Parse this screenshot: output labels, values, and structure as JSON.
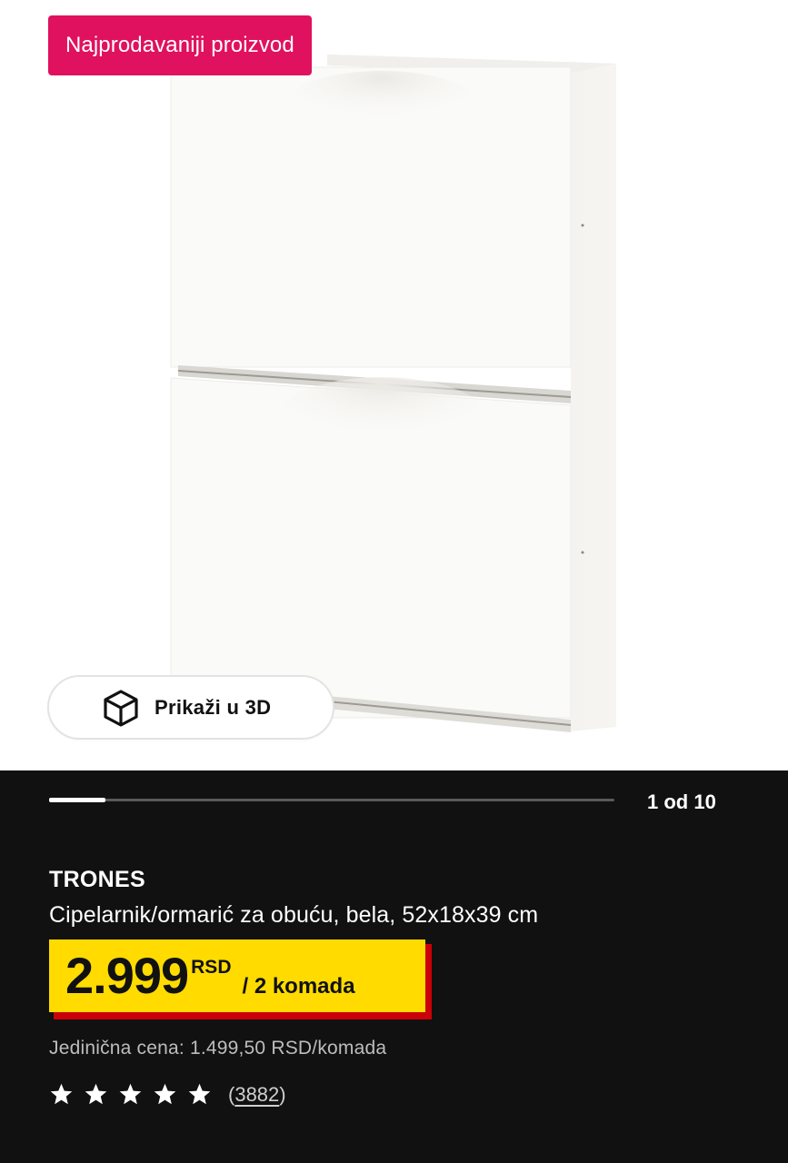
{
  "gallery": {
    "badge": "Najprodavaniji proizvod",
    "view_3d_label": "Prikaži u 3D",
    "image_description": "white shoe cabinet with two tilting compartments",
    "progress": 0.1,
    "pager": "1 od 10"
  },
  "product": {
    "name": "TRONES",
    "description": "Cipelarnik/ormarić za obuću, bela, 52x18x39 cm",
    "price": {
      "amount": "2.999",
      "currency": "RSD",
      "unit": "/ 2 komada"
    },
    "unit_price": "Jedinična cena: 1.499,50 RSD/komada",
    "rating": {
      "stars": 5,
      "max": 5,
      "review_open": "(",
      "review_count": "3882",
      "review_close": ")"
    }
  },
  "colors": {
    "badge": "#e0115f",
    "price_bg": "#ffdb00",
    "price_shadow": "#cc0008",
    "info_bg": "#111111"
  },
  "icons": {
    "view_3d": "cube-icon",
    "star": "star-icon"
  }
}
